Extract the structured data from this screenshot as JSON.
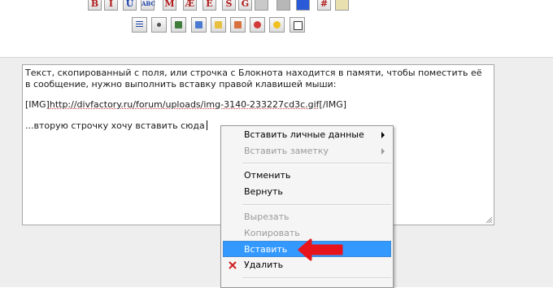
{
  "toolbar": {
    "row1": [
      {
        "name": "bold-button",
        "text": "B"
      },
      {
        "name": "italic-button",
        "text": "I"
      },
      {
        "name": "underline-button",
        "text": "U"
      },
      {
        "name": "abc-button",
        "text": "ABC"
      },
      {
        "name": "monospace-button",
        "text": "M"
      },
      {
        "name": "font-icon-button",
        "text": "Ӕ"
      },
      {
        "name": "e-button",
        "text": "E"
      },
      {
        "name": "strike-button",
        "text": "S"
      },
      {
        "name": "g-button",
        "text": "G"
      },
      {
        "name": "hash-button",
        "text": "#"
      }
    ],
    "row2_icons": [
      "list-icon",
      "bullet-icon",
      "link-icon",
      "globe-icon",
      "email-icon",
      "image-icon",
      "flash-icon",
      "smiley-icon",
      "help-icon"
    ]
  },
  "editor": {
    "line1": "Текст, скопированный с поля, или строчка с Блокнота находится в памяти, чтобы поместить её",
    "line2": "в сообщение, нужно выполнить вставку правой клавишей мыши:",
    "line3_pre": "[IMG]",
    "line3_url": "http://divfactory.ru/forum/uploads/img-3140-233227cd3c.gif",
    "line3_post": "[/IMG]",
    "line4": "...вторую строчку хочу вставить сюда"
  },
  "context_menu": {
    "insert_personal": "Вставить личные данные",
    "insert_note": "Вставить заметку",
    "undo": "Отменить",
    "redo": "Вернуть",
    "cut": "Вырезать",
    "copy": "Копировать",
    "paste": "Вставить",
    "delete": "Удалить"
  },
  "colors": {
    "highlight": "#3399ff",
    "annotation_arrow": "#e8141c",
    "disabled_text": "#9a9a9a"
  }
}
